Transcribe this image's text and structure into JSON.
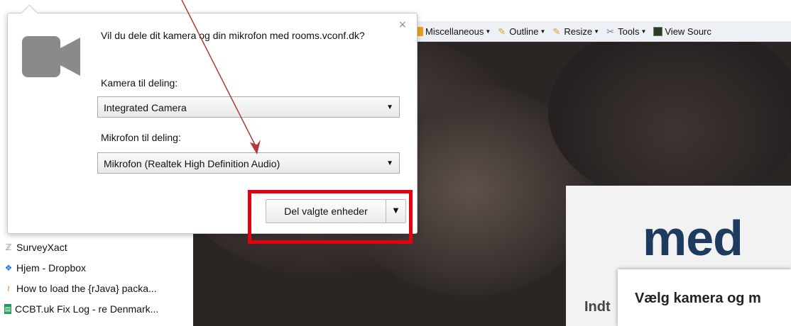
{
  "toolbar": {
    "items": [
      {
        "label": "Miscellaneous",
        "icon": "folder-icon"
      },
      {
        "label": "Outline",
        "icon": "pencil-icon"
      },
      {
        "label": "Resize",
        "icon": "pencil-icon"
      },
      {
        "label": "Tools",
        "icon": "tools-icon"
      },
      {
        "label": "View Sourc",
        "icon": "monitor-icon"
      }
    ]
  },
  "bookmarks": [
    {
      "label": "SurveyXact",
      "icon": "survey-icon"
    },
    {
      "label": "Hjem - Dropbox",
      "icon": "dropbox-icon"
    },
    {
      "label": "How to load the {rJava} packa...",
      "icon": "stackoverflow-icon"
    },
    {
      "label": "CCBT.uk Fix Log - re Denmark...",
      "icon": "sheets-icon"
    }
  ],
  "popup": {
    "question": "Vil du dele dit kamera og din mikrofon med rooms.vconf.dk?",
    "close": "×",
    "camera_label": "Kamera til deling:",
    "camera_value": "Integrated Camera",
    "mic_label": "Mikrofon til deling:",
    "mic_value": "Mikrofon (Realtek High Definition Audio)",
    "share_button": "Del valgte enheder",
    "dropdown_glyph": "▼"
  },
  "page": {
    "logo_text": "med",
    "partial_text": "Indt",
    "modal_title": "Vælg kamera og m"
  },
  "colors": {
    "annotation_red": "#e3000f",
    "arrow": "#b23a3a",
    "logo": "#1c3b5e"
  }
}
